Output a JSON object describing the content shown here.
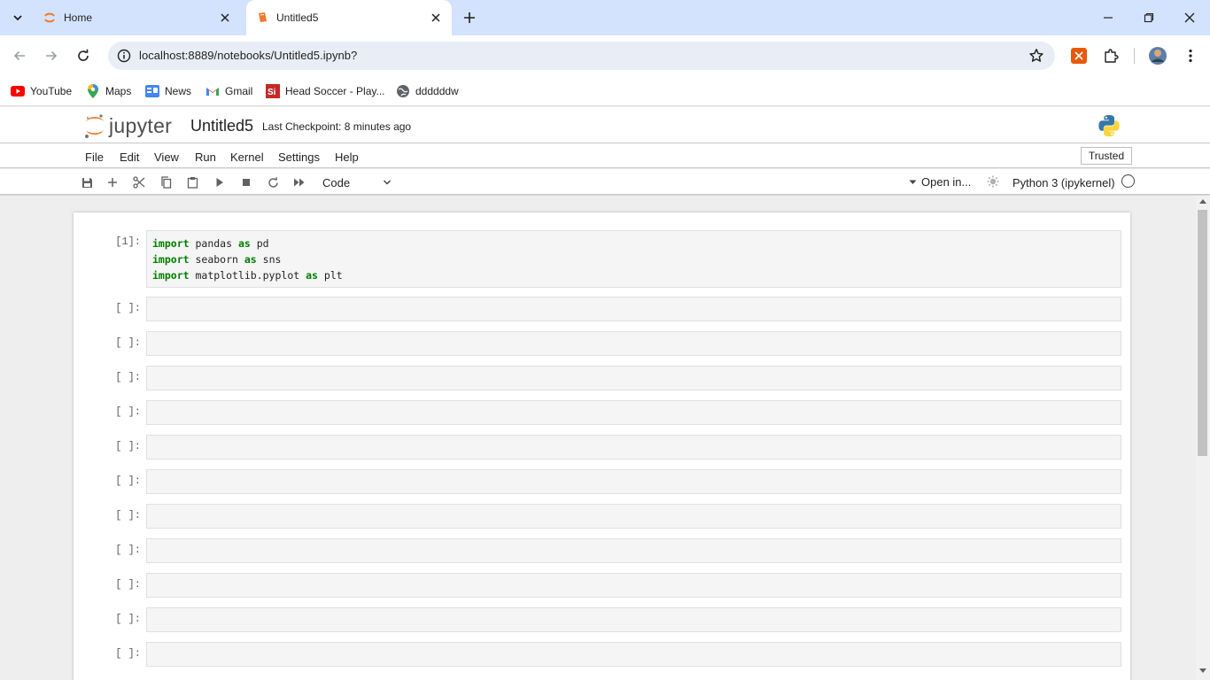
{
  "browser": {
    "tabs": [
      {
        "title": "Home",
        "favicon": "jupyter-favicon"
      },
      {
        "title": "Untitled5",
        "favicon": "notebook-favicon"
      }
    ],
    "url": "localhost:8889/notebooks/Untitled5.ipynb?",
    "bookmarks": [
      {
        "label": "YouTube",
        "icon": "youtube-icon"
      },
      {
        "label": "Maps",
        "icon": "maps-icon"
      },
      {
        "label": "News",
        "icon": "news-icon"
      },
      {
        "label": "Gmail",
        "icon": "gmail-icon"
      },
      {
        "label": "Head Soccer - Play...",
        "icon": "head-soccer-icon"
      },
      {
        "label": "ddddddw",
        "icon": "globe-icon"
      }
    ]
  },
  "jupyter": {
    "logo_text": "jupyter",
    "notebook_name": "Untitled5",
    "checkpoint": "Last Checkpoint: 8 minutes ago",
    "menu": [
      "File",
      "Edit",
      "View",
      "Run",
      "Kernel",
      "Settings",
      "Help"
    ],
    "trusted": "Trusted",
    "cell_type": "Code",
    "open_in": "Open in...",
    "kernel_name": "Python 3 (ipykernel)"
  },
  "cells": {
    "first": {
      "prompt": "[1]:",
      "lines": [
        {
          "kw1": "import",
          "mod": " pandas ",
          "kw2": "as",
          "alias": " pd"
        },
        {
          "kw1": "import",
          "mod": " seaborn ",
          "kw2": "as",
          "alias": " sns"
        },
        {
          "kw1": "import",
          "mod": " matplotlib.pyplot ",
          "kw2": "as",
          "alias": " plt"
        }
      ]
    },
    "empty_prompt": "[ ]:",
    "empty_count": 11
  },
  "colors": {
    "tabstrip": "#d3e3fd",
    "keyword": "#008000",
    "jupyter_orange": "#f37726"
  }
}
